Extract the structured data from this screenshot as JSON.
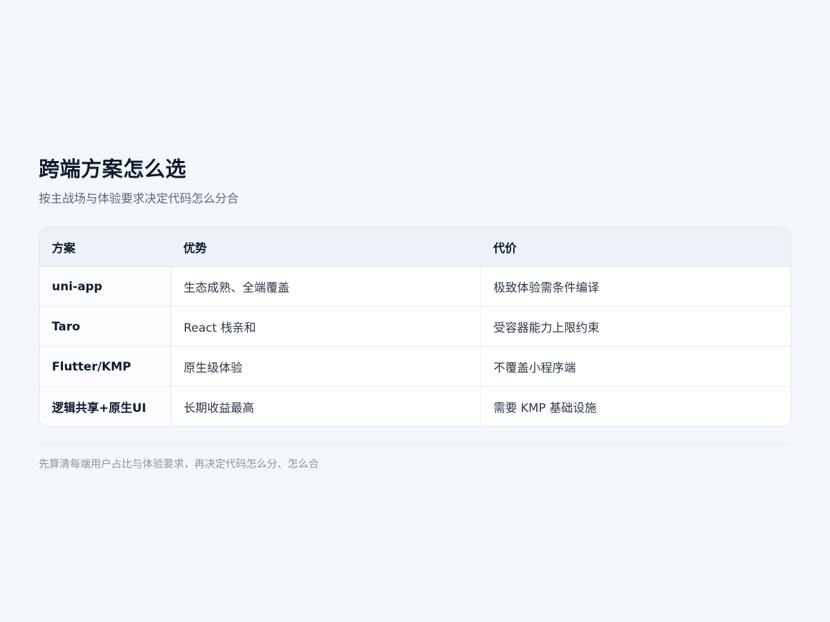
{
  "header": {
    "title": "跨端方案怎么选",
    "subtitle": "按主战场与体验要求决定代码怎么分合"
  },
  "table": {
    "columns": [
      "方案",
      "优势",
      "代价"
    ],
    "rows": [
      [
        "uni-app",
        "生态成熟、全端覆盖",
        "极致体验需条件编译"
      ],
      [
        "Taro",
        "React 栈亲和",
        "受容器能力上限约束"
      ],
      [
        "Flutter/KMP",
        "原生级体验",
        "不覆盖小程序端"
      ],
      [
        "逻辑共享+原生UI",
        "长期收益最高",
        "需要 KMP 基础设施"
      ]
    ]
  },
  "footer": {
    "note": "先算清每端用户占比与体验要求，再决定代码怎么分、怎么合"
  },
  "colors": {
    "background": "#f4f7fb",
    "header_bg": "#edf2f9",
    "title": "#0f1b2d",
    "border": "#dfe5ed"
  }
}
